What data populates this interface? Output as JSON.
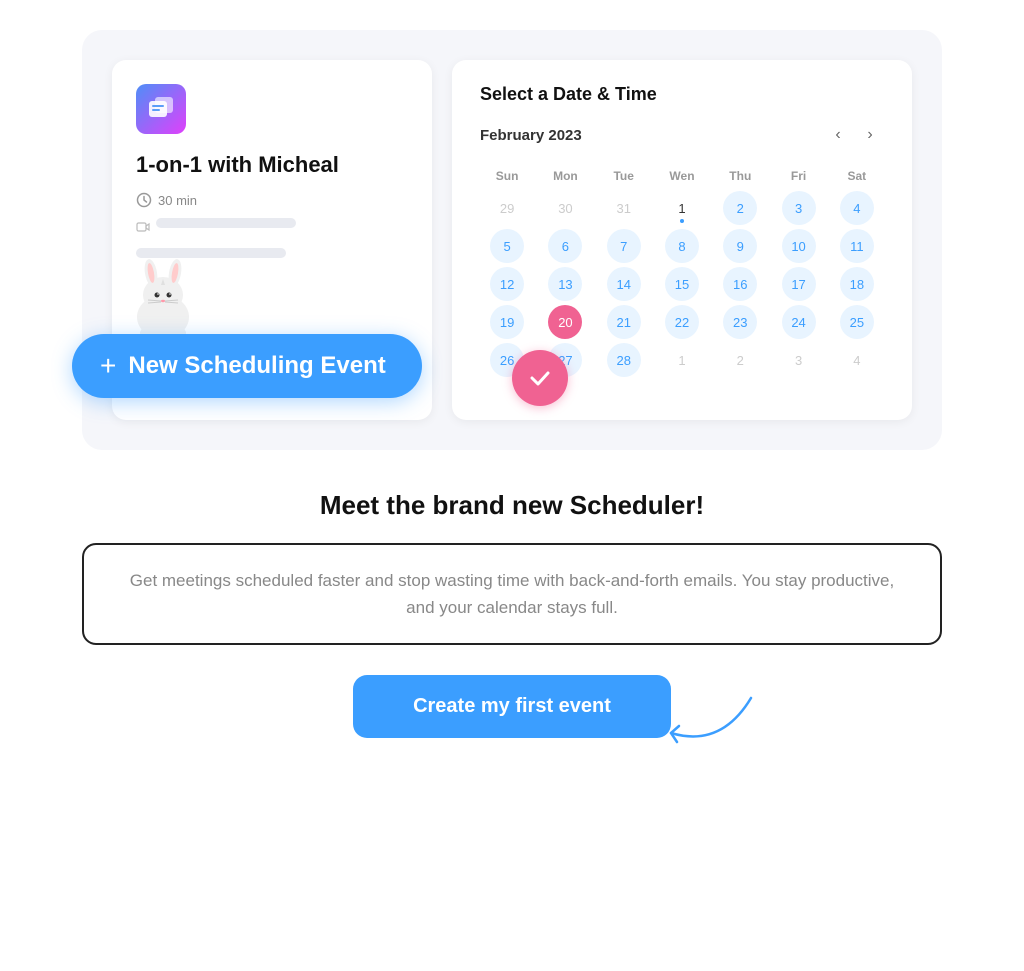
{
  "hero": {
    "left_panel": {
      "event_title": "1-on-1 with Micheal",
      "event_duration": "30 min"
    },
    "new_event_btn": {
      "plus": "+",
      "label": "New Scheduling Event"
    },
    "calendar": {
      "section_title": "Select a Date & Time",
      "month_label": "February 2023",
      "nav_prev": "‹",
      "nav_next": "›",
      "day_headers": [
        "Sun",
        "Mon",
        "Tue",
        "Wen",
        "Thu",
        "Fri",
        "Sat"
      ],
      "weeks": [
        [
          {
            "day": "29",
            "type": "other-month"
          },
          {
            "day": "30",
            "type": "other-month"
          },
          {
            "day": "31",
            "type": "other-month"
          },
          {
            "day": "1",
            "type": "normal",
            "dot": true
          },
          {
            "day": "2",
            "type": "available"
          },
          {
            "day": "3",
            "type": "available"
          },
          {
            "day": "4",
            "type": "available"
          }
        ],
        [
          {
            "day": "5",
            "type": "available"
          },
          {
            "day": "6",
            "type": "available"
          },
          {
            "day": "7",
            "type": "available"
          },
          {
            "day": "8",
            "type": "available"
          },
          {
            "day": "9",
            "type": "available"
          },
          {
            "day": "10",
            "type": "available"
          },
          {
            "day": "11",
            "type": "available"
          }
        ],
        [
          {
            "day": "12",
            "type": "available"
          },
          {
            "day": "13",
            "type": "available"
          },
          {
            "day": "14",
            "type": "available"
          },
          {
            "day": "15",
            "type": "available"
          },
          {
            "day": "16",
            "type": "available"
          },
          {
            "day": "17",
            "type": "available"
          },
          {
            "day": "18",
            "type": "available"
          }
        ],
        [
          {
            "day": "19",
            "type": "available"
          },
          {
            "day": "20",
            "type": "selected"
          },
          {
            "day": "21",
            "type": "available"
          },
          {
            "day": "22",
            "type": "available"
          },
          {
            "day": "23",
            "type": "available"
          },
          {
            "day": "24",
            "type": "available"
          },
          {
            "day": "25",
            "type": "available"
          }
        ],
        [
          {
            "day": "26",
            "type": "available"
          },
          {
            "day": "27",
            "type": "available"
          },
          {
            "day": "28",
            "type": "available"
          },
          {
            "day": "1",
            "type": "other-month"
          },
          {
            "day": "2",
            "type": "other-month"
          },
          {
            "day": "3",
            "type": "other-month"
          },
          {
            "day": "4",
            "type": "other-month"
          }
        ]
      ]
    }
  },
  "bottom": {
    "headline": "Meet the brand new Scheduler!",
    "description": "Get meetings scheduled faster and stop wasting time with back-and-forth emails. You stay productive, and your calendar stays full.",
    "cta_label": "Create my first event"
  }
}
